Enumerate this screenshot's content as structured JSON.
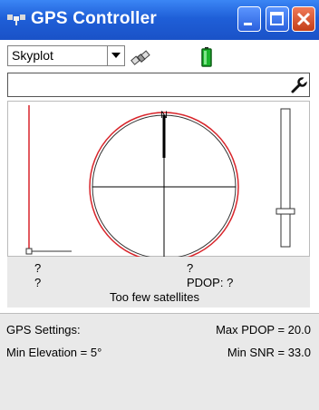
{
  "window": {
    "title": "GPS Controller"
  },
  "toolbar": {
    "view_select_value": "Skyplot"
  },
  "info": {
    "left_line1": "?",
    "left_line2": "?",
    "mid_line1": "?",
    "pdop": "PDOP: ?",
    "status": "Too few satellites"
  },
  "settings": {
    "heading": "GPS Settings:",
    "max_pdop": "Max PDOP = 20.0",
    "min_elevation": "Min Elevation = 5°",
    "min_snr": "Min SNR = 33.0"
  },
  "skyplot": {
    "north_label": "N"
  },
  "colors": {
    "titlebar": "#1f5fd8",
    "ring": "#e0282b",
    "panel": "#e9e9e9"
  },
  "icons": [
    "gps-app-icon",
    "minimize-icon",
    "maximize-icon",
    "close-icon",
    "satellite-icon",
    "battery-icon",
    "wrench-icon"
  ]
}
